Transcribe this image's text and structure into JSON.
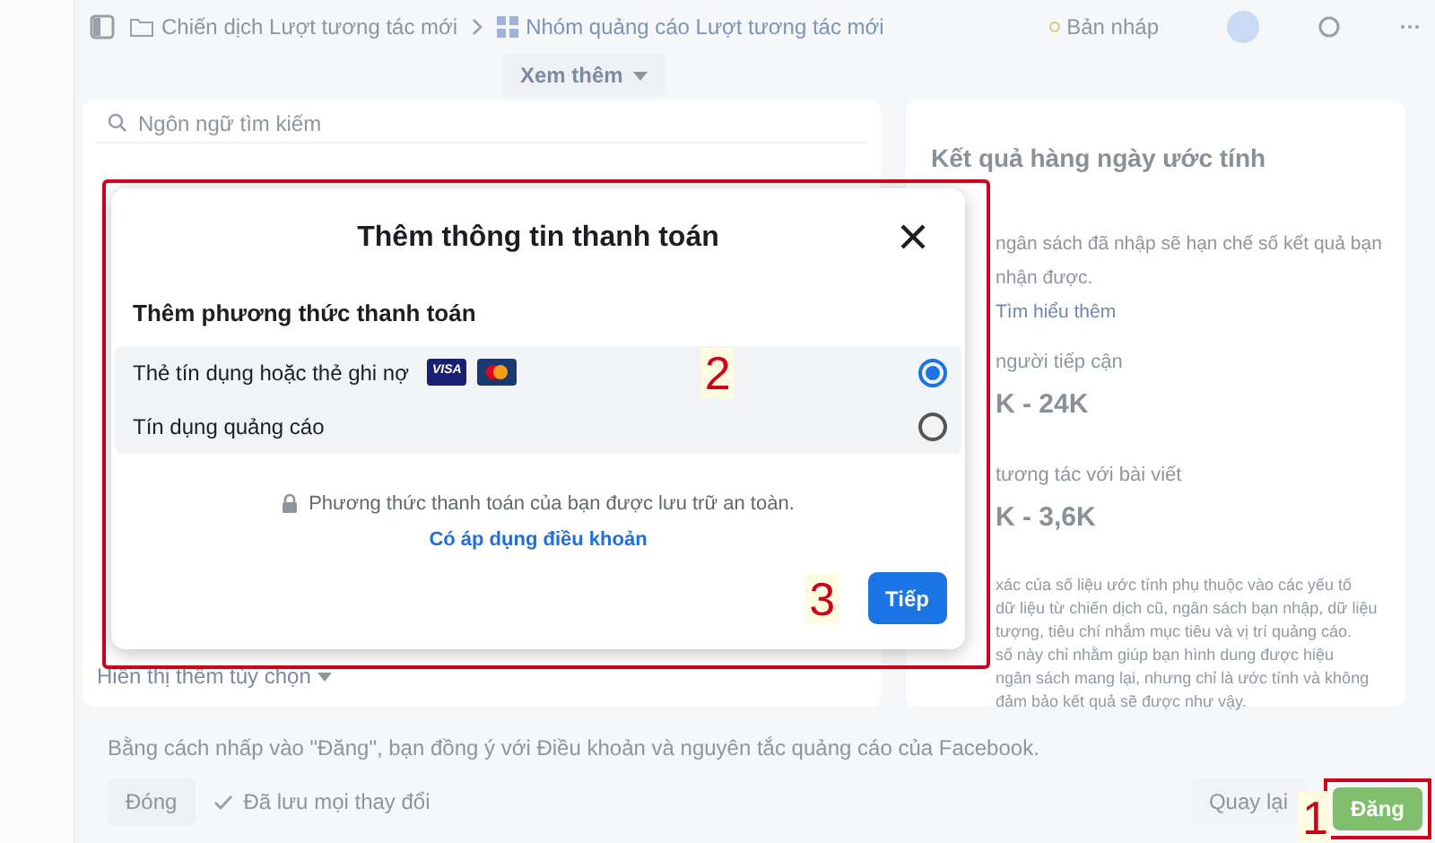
{
  "header": {
    "breadcrumbs": [
      {
        "label": "Chiến dịch Lượt tương tác mới"
      },
      {
        "label": "Nhóm quảng cáo Lượt tương tác mới"
      }
    ],
    "status": "Bản nháp",
    "more_button": "Xem thêm"
  },
  "left_panel": {
    "search": {
      "placeholder": "Ngôn ngữ tìm kiếm"
    },
    "more_options": "Hiển thị thêm tùy chọn"
  },
  "right_panel": {
    "title": "Kết quả hàng ngày ước tính",
    "notice": [
      "ngân sách đã nhập sẽ hạn chế số kết quả bạn",
      "nhận được."
    ],
    "link": "Tìm hiểu thêm",
    "metrics": [
      {
        "label": "người tiếp cận",
        "value": "K - 24K"
      },
      {
        "label": "tương tác với bài viết",
        "value": "K - 3,6K"
      }
    ],
    "disclaimer": [
      "xác của số liệu ước tính phụ thuộc vào các yếu tố",
      "dữ liệu từ chiến dịch cũ, ngân sách bạn nhập, dữ liệu",
      "tượng, tiêu chí nhắm mục tiêu và vị trí quảng cáo.",
      "số này chỉ nhằm giúp bạn hình dung được hiệu",
      "ngân sách mang lại, nhưng chỉ là ước tính và không",
      "đảm bảo kết quả sẽ được như vậy."
    ]
  },
  "footer": {
    "agreement": "Bằng cách nhấp vào \"Đăng\", bạn đồng ý với Điều khoản và nguyên tắc quảng cáo của Facebook.",
    "close_button": "Đóng",
    "saved": "Đã lưu mọi thay đổi",
    "back_button": "Quay lại",
    "publish_button": "Đăng"
  },
  "dialog": {
    "title": "Thêm thông tin thanh toán",
    "section": "Thêm phương thức thanh toán",
    "options": [
      {
        "label": "Thẻ tín dụng hoặc thẻ ghi nợ",
        "card_logo": "VISA",
        "selected": true
      },
      {
        "label": "Tín dụng quảng cáo",
        "selected": false
      }
    ],
    "security_note": "Phương thức thanh toán của bạn được lưu trữ an toàn.",
    "terms_link": "Có áp dụng điều khoản",
    "next_button": "Tiếp"
  },
  "annotations": [
    {
      "label": "2"
    },
    {
      "label": "3"
    },
    {
      "label": "1"
    }
  ]
}
